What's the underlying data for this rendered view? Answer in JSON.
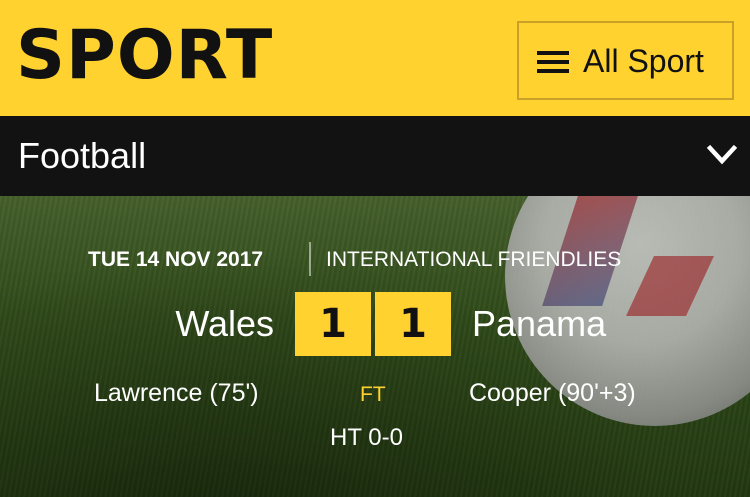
{
  "header": {
    "logo": "SPORT",
    "all_sport_label": "All Sport",
    "icons": {
      "menu": "hamburger-icon"
    },
    "colors": {
      "brand_yellow": "#ffd230",
      "nav_dark": "#121212"
    }
  },
  "subnav": {
    "section_title": "Football",
    "icons": {
      "expand": "chevron-down-icon"
    }
  },
  "match": {
    "date": "TUE 14 NOV 2017",
    "competition": "INTERNATIONAL FRIENDLIES",
    "home_team": "Wales",
    "away_team": "Panama",
    "home_score": "1",
    "away_score": "1",
    "home_scorer": "Lawrence (75')",
    "away_scorer": "Cooper (90'+3)",
    "status": "FT",
    "half_time": "HT 0-0"
  }
}
